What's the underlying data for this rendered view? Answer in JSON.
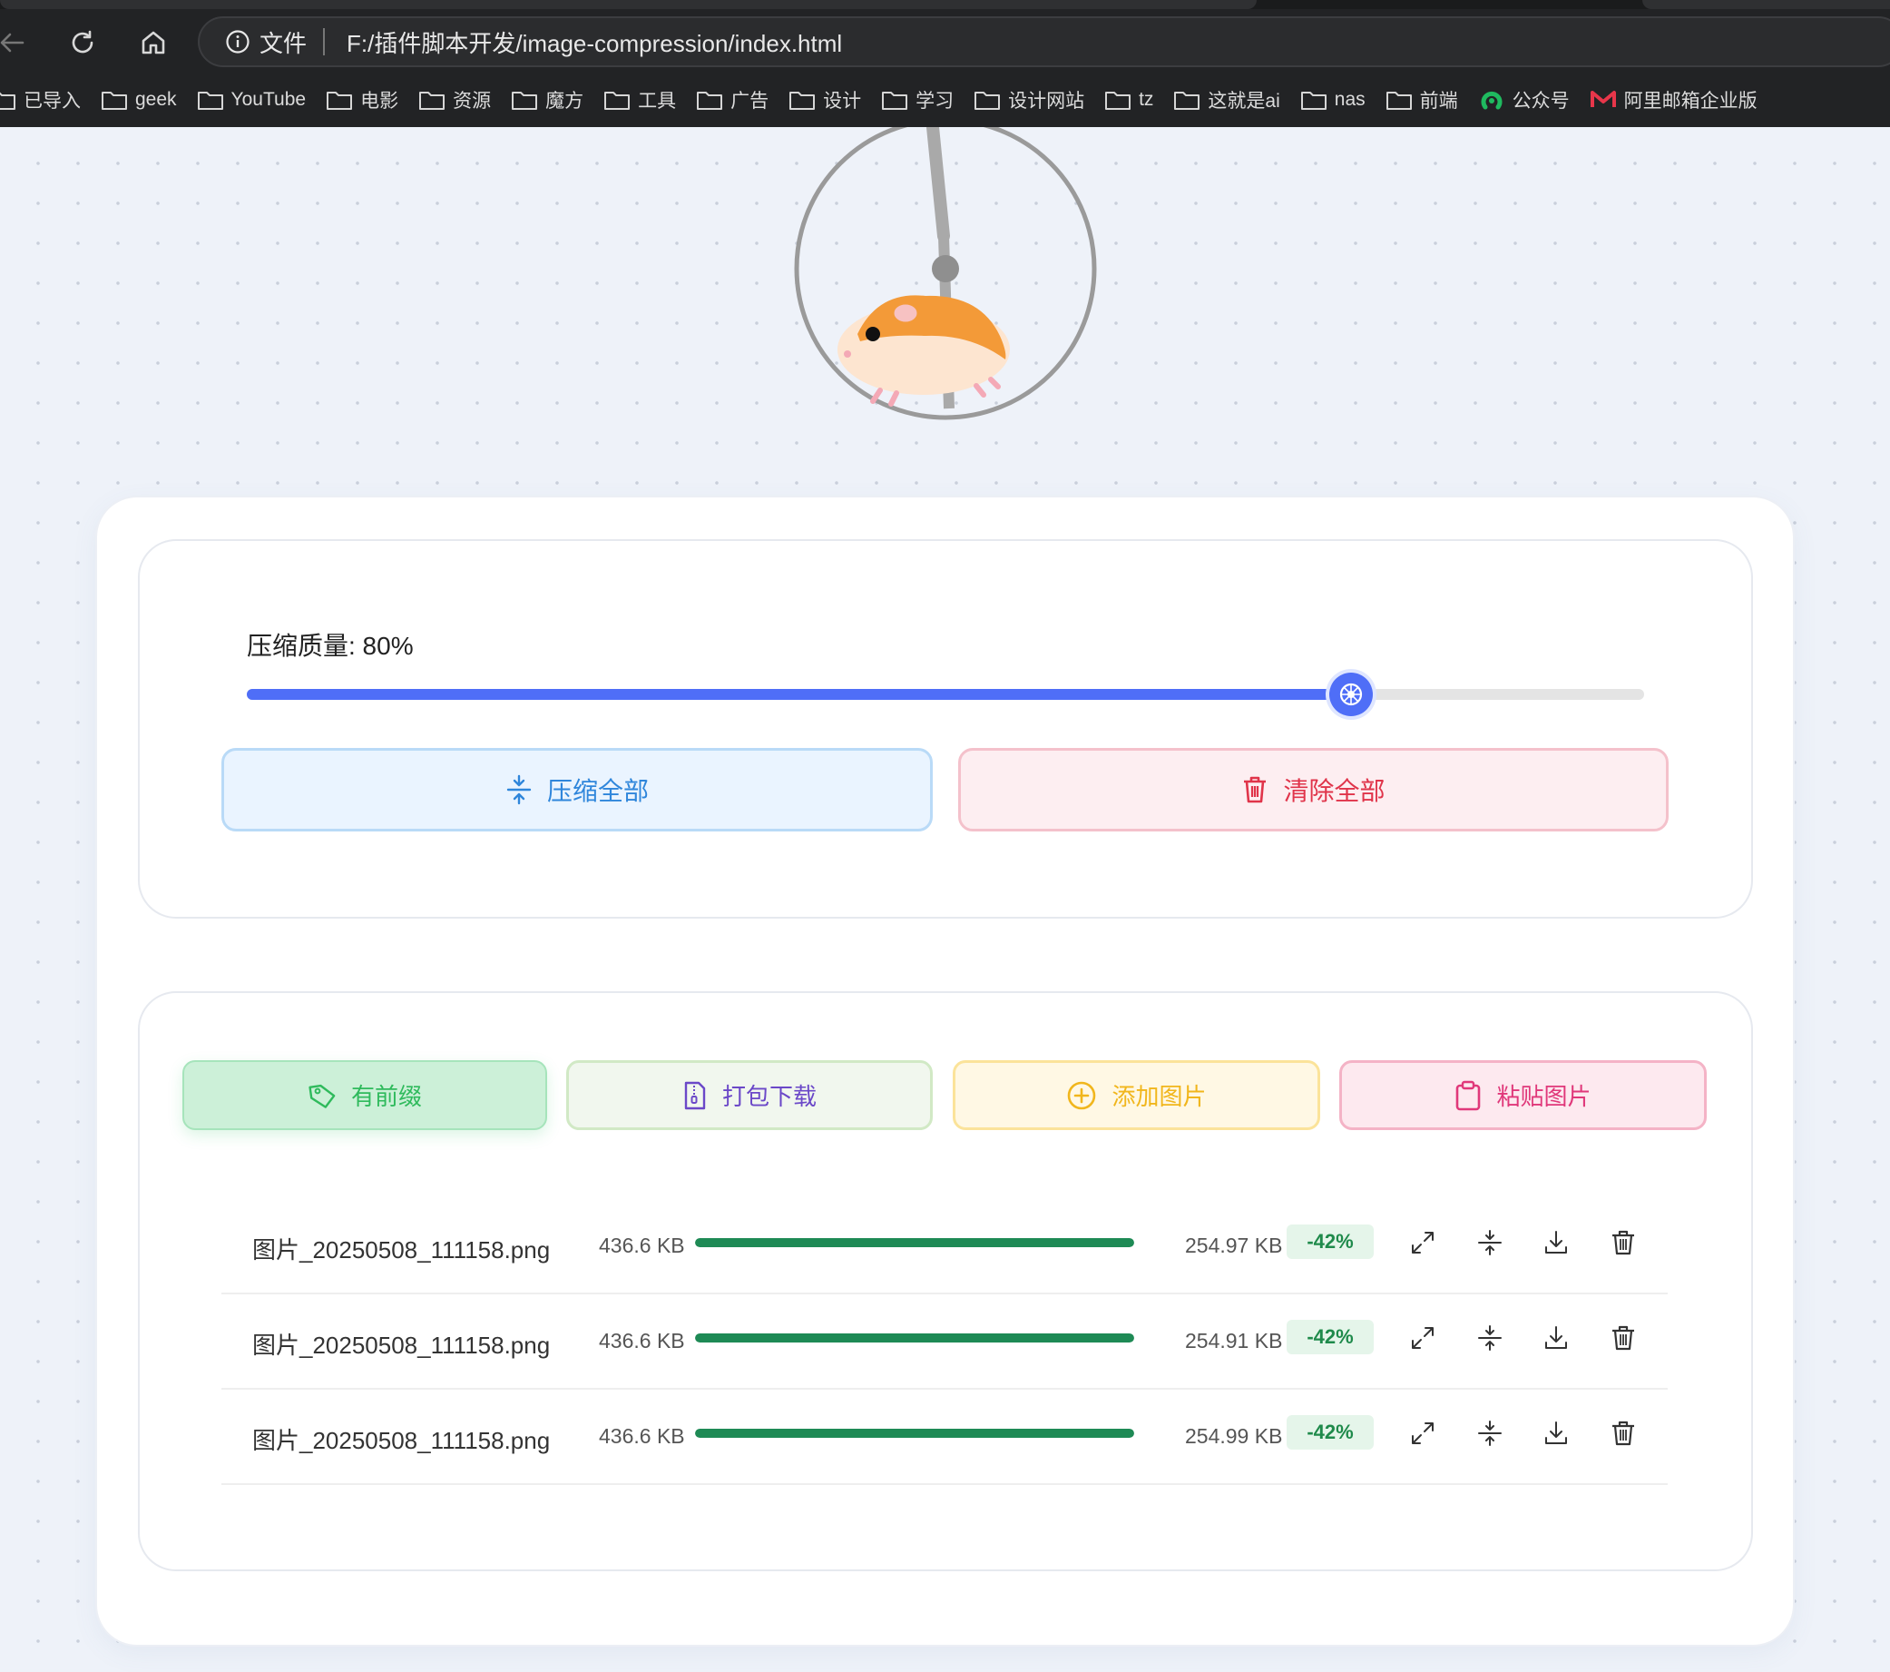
{
  "browser": {
    "site_label": "文件",
    "url": "F:/插件脚本开发/image-compression/index.html",
    "bookmarks": [
      {
        "label": "已导入",
        "icon": "folder-icon"
      },
      {
        "label": "geek",
        "icon": "folder-icon"
      },
      {
        "label": "YouTube",
        "icon": "folder-icon"
      },
      {
        "label": "电影",
        "icon": "folder-icon"
      },
      {
        "label": "资源",
        "icon": "folder-icon"
      },
      {
        "label": "魔方",
        "icon": "folder-icon"
      },
      {
        "label": "工具",
        "icon": "folder-icon"
      },
      {
        "label": "广告",
        "icon": "folder-icon"
      },
      {
        "label": "设计",
        "icon": "folder-icon"
      },
      {
        "label": "学习",
        "icon": "folder-icon"
      },
      {
        "label": "设计网站",
        "icon": "folder-icon"
      },
      {
        "label": "tz",
        "icon": "folder-icon"
      },
      {
        "label": "这就是ai",
        "icon": "folder-icon"
      },
      {
        "label": "nas",
        "icon": "folder-icon"
      },
      {
        "label": "前端",
        "icon": "folder-icon"
      },
      {
        "label": "公众号",
        "icon": "wechat-icon"
      },
      {
        "label": "阿里邮箱企业版",
        "icon": "mail-icon"
      }
    ]
  },
  "settings": {
    "quality_label": "压缩质量: 80%",
    "quality_value": 0.79,
    "compress_all_label": "压缩全部",
    "clear_all_label": "清除全部"
  },
  "actions": {
    "prefix_label": "有前缀",
    "zip_download_label": "打包下载",
    "add_image_label": "添加图片",
    "paste_image_label": "粘贴图片"
  },
  "files": [
    {
      "name": "图片_20250508_111158.png",
      "original_size": "436.6 KB",
      "compressed_size": "254.97 KB",
      "ratio": "-42%",
      "progress": 1.0
    },
    {
      "name": "图片_20250508_111158.png",
      "original_size": "436.6 KB",
      "compressed_size": "254.91 KB",
      "ratio": "-42%",
      "progress": 1.0
    },
    {
      "name": "图片_20250508_111158.png",
      "original_size": "436.6 KB",
      "compressed_size": "254.99 KB",
      "ratio": "-42%",
      "progress": 1.0
    }
  ],
  "colors": {
    "accent_blue": "#4f6ef7",
    "progress_green": "#1e8a55",
    "danger_red": "#e0344a"
  }
}
